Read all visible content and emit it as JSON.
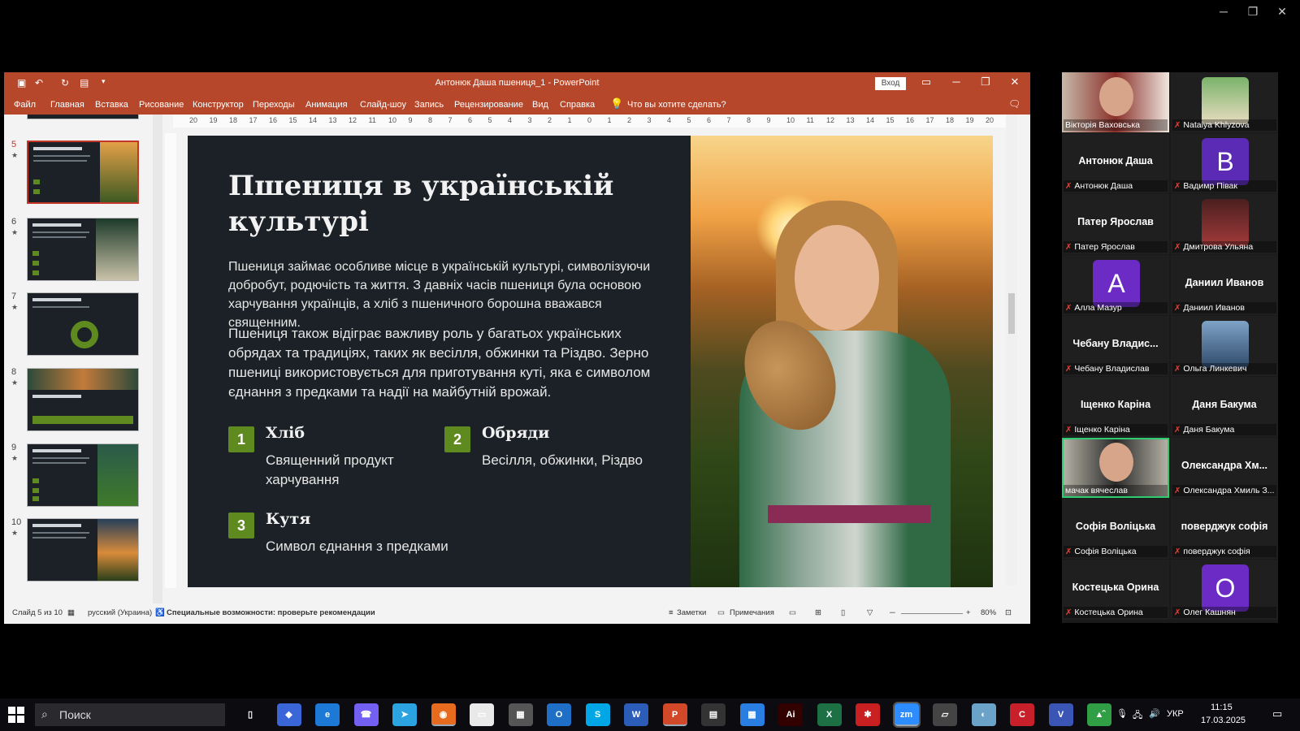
{
  "window": {
    "title": "Антонюк Даша пшениця_1  -  PowerPoint",
    "signin_label": "Вход"
  },
  "ribbon": {
    "tabs": [
      "Файл",
      "Главная",
      "Вставка",
      "Рисование",
      "Конструктор",
      "Переходы",
      "Анимация",
      "Слайд-шоу",
      "Запись",
      "Рецензирование",
      "Вид",
      "Справка"
    ],
    "tell_me": "Что вы хотите сделать?"
  },
  "thumbnails": [
    {
      "num": "5",
      "selected": true
    },
    {
      "num": "6",
      "selected": false
    },
    {
      "num": "7",
      "selected": false
    },
    {
      "num": "8",
      "selected": false
    },
    {
      "num": "9",
      "selected": false
    },
    {
      "num": "10",
      "selected": false
    }
  ],
  "slide": {
    "title": "Пшениця в українській культурі",
    "para1": "Пшениця займає особливе місце в українській культурі, символізуючи добробут, родючість та життя. З давніх часів пшениця була основою харчування українців, а хліб з пшеничного борошна вважався священним.",
    "para2": "Пшениця також відіграє важливу роль у багатьох українських обрядах та традиціях, таких як весілля, обжинки та Різдво. Зерно пшениці використовується для приготування куті, яка є символом єднання з предками та надії на майбутній врожай.",
    "features": [
      {
        "num": "1",
        "title": "Хліб",
        "desc": "Священний продукт харчування"
      },
      {
        "num": "2",
        "title": "Обряди",
        "desc": "Весілля, обжинки, Різдво"
      },
      {
        "num": "3",
        "title": "Кутя",
        "desc": "Символ єднання з предками"
      }
    ]
  },
  "status": {
    "slide_info": "Слайд 5 из 10",
    "language": "русский (Украина)",
    "accessibility": "Специальные возможности: проверьте рекомендации",
    "notes": "Заметки",
    "comments": "Примечания",
    "zoom": "80%"
  },
  "participants": [
    {
      "display": "",
      "label": "Вікторія Ваховська",
      "type": "video",
      "muted": false
    },
    {
      "display": "",
      "label": "Natalya Khlyzova",
      "type": "avatar",
      "muted": true
    },
    {
      "display": "Антонюк Даша",
      "label": "Антонюк Даша",
      "type": "name",
      "muted": true
    },
    {
      "display": "B",
      "label": "Вадимр Півак",
      "type": "letter",
      "color": "#5b2bb5",
      "muted": true
    },
    {
      "display": "Патер Ярослав",
      "label": "Патер Ярослав",
      "type": "name",
      "muted": true
    },
    {
      "display": "",
      "label": "Дмитрова Ульяна",
      "type": "avatar",
      "muted": true
    },
    {
      "display": "A",
      "label": "Алла Мазур",
      "type": "letter",
      "color": "#6b2bc4",
      "muted": true
    },
    {
      "display": "Даниил Иванов",
      "label": "Даниил Иванов",
      "type": "name",
      "muted": true
    },
    {
      "display": "Чебану Владис...",
      "label": "Чебану Владислав",
      "type": "name",
      "muted": true
    },
    {
      "display": "",
      "label": "Ольга Линкевич",
      "type": "avatar",
      "muted": true
    },
    {
      "display": "Іщенко Каріна",
      "label": "Іщенко Каріна",
      "type": "name",
      "muted": true
    },
    {
      "display": "Даня Бакума",
      "label": "Даня Бакума",
      "type": "name",
      "muted": true
    },
    {
      "display": "",
      "label": "мачак вячеслав",
      "type": "video",
      "muted": false,
      "active": true
    },
    {
      "display": "Олександра Хм...",
      "label": "Олександра Хмиль З...",
      "type": "name",
      "muted": true
    },
    {
      "display": "Софія Воліцька",
      "label": "Софія Воліцька",
      "type": "name",
      "muted": true
    },
    {
      "display": "поверджук софія",
      "label": "поверджук софія",
      "type": "name",
      "muted": true
    },
    {
      "display": "Костецька Орина",
      "label": "Костецька Орина",
      "type": "name",
      "muted": true
    },
    {
      "display": "O",
      "label": "Олег Кашнян",
      "type": "letter",
      "color": "#6b2bc4",
      "muted": true
    }
  ],
  "taskbar": {
    "search_placeholder": "Поиск",
    "apps": [
      "task-view",
      "copilot",
      "edge",
      "viber",
      "telegram",
      "firefox",
      "notepad",
      "calculator",
      "outlook",
      "skype",
      "word",
      "powerpoint",
      "calendar",
      "calendar2",
      "illustrator",
      "excel",
      "app-red",
      "zoom",
      "app-scanner",
      "app-colors",
      "app-c",
      "visio",
      "google-drive"
    ],
    "lang": "УКР",
    "time": "11:15",
    "date": "17.03.2025"
  },
  "colors": {
    "ppt_accent": "#b7472a",
    "slide_bg": "#1b2126",
    "badge_green": "#5f8a1f",
    "active_speaker": "#2ecc71"
  }
}
